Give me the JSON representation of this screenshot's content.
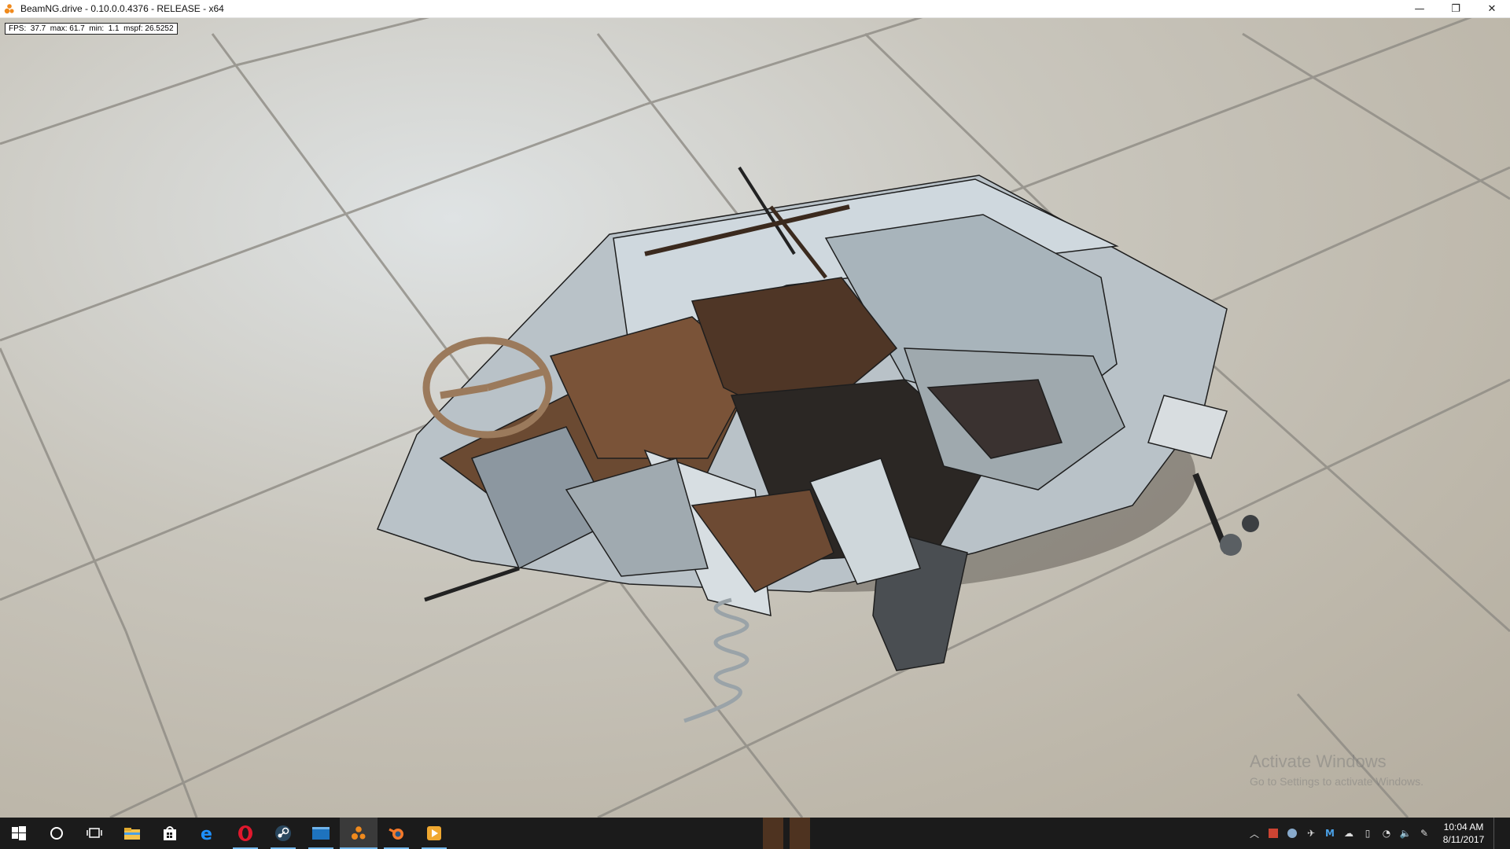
{
  "window": {
    "title": "BeamNG.drive - 0.10.0.0.4376 - RELEASE - x64",
    "minimize_glyph": "—",
    "maximize_glyph": "❐",
    "close_glyph": "✕"
  },
  "overlay": {
    "fps_text": "FPS:  37.7  max: 61.7  min:  1.1  mspf: 26.5252"
  },
  "watermark": {
    "title": "Activate Windows",
    "subtitle": "Go to Settings to activate Windows."
  },
  "taskbar": {
    "apps": [
      {
        "name": "start",
        "icon": "windows-logo-icon"
      },
      {
        "name": "cortana",
        "icon": "cortana-circle-icon"
      },
      {
        "name": "task-view",
        "icon": "task-view-icon"
      },
      {
        "name": "file-explorer",
        "icon": "folder-icon"
      },
      {
        "name": "store",
        "icon": "store-icon"
      },
      {
        "name": "edge",
        "icon": "edge-icon"
      },
      {
        "name": "opera",
        "icon": "opera-icon"
      },
      {
        "name": "steam",
        "icon": "steam-icon"
      },
      {
        "name": "app-9",
        "icon": "window-app-icon"
      },
      {
        "name": "beamng",
        "icon": "beamng-icon"
      },
      {
        "name": "blender",
        "icon": "blender-icon"
      },
      {
        "name": "media-player",
        "icon": "media-player-icon"
      }
    ],
    "clock_time": "10:04 AM",
    "clock_date": "8/11/2017",
    "colors": {
      "bar": "#1b1b1b",
      "accent": "#76b9ed"
    }
  }
}
